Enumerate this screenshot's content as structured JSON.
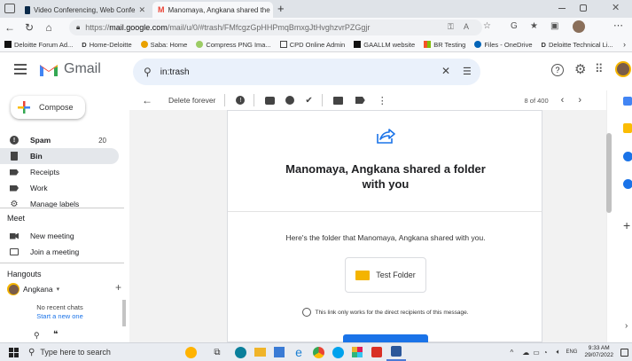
{
  "browser": {
    "tabs": [
      {
        "label": "Video Conferencing, Web Confe",
        "active": false
      },
      {
        "label": "Manomaya, Angkana shared the",
        "active": true
      }
    ],
    "new_tab": "+",
    "url_scheme": "https://",
    "url_host": "mail.google.com",
    "url_rest": "/mail/u/0/#trash/FMfcgzGpHHPmqBmxgJtHvghzvrPZGgjr",
    "favorites": [
      "Deloitte Forum Ad...",
      "Home-Deloitte",
      "Saba: Home",
      "Compress PNG Ima...",
      "CPD Online Admin",
      "GAALLM website",
      "BR Testing",
      "Files - OneDrive",
      "Deloitte Technical Li..."
    ]
  },
  "gmail": {
    "logo_text": "Gmail",
    "search_value": "in:trash",
    "compose_label": "Compose",
    "sidebar_items": [
      {
        "label": "Spam",
        "count": "20",
        "icon": "spam-icon"
      },
      {
        "label": "Bin",
        "count": "",
        "icon": "bin-icon"
      },
      {
        "label": "Receipts",
        "count": "",
        "icon": "label-icon"
      },
      {
        "label": "Work",
        "count": "",
        "icon": "label-icon"
      },
      {
        "label": "Manage labels",
        "count": "",
        "icon": "gear-icon"
      }
    ],
    "meet_title": "Meet",
    "meet_items": [
      "New meeting",
      "Join a meeting"
    ],
    "hangouts_title": "Hangouts",
    "hangouts_user": "Angkana",
    "no_chats": "No recent chats",
    "new_chat": "Start a new one",
    "toolbar_delete": "Delete forever",
    "pager": "8 of 400"
  },
  "email": {
    "title": "Manomaya, Angkana shared a folder with you",
    "body": "Here's the folder that Manomaya, Angkana shared with you.",
    "folder_name": "Test Folder",
    "note": "This link only works for the direct recipients of this message."
  },
  "taskbar": {
    "search_placeholder": "Type here to search",
    "time": "9:33 AM",
    "date": "29/07/2022",
    "lang": "ENG"
  },
  "colors": {
    "gmail_red": "#ea4335",
    "folder_yellow": "#f4b400",
    "share_blue": "#1a73e8",
    "search_bg": "#eaf1fb"
  }
}
